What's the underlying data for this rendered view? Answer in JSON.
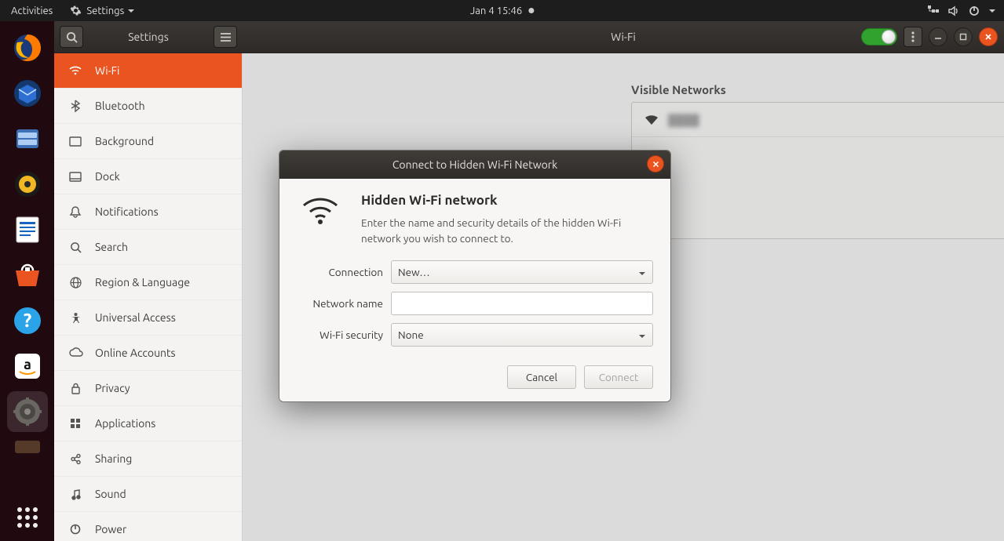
{
  "topbar": {
    "activities": "Activities",
    "app_menu": "Settings",
    "clock": "Jan 4  15:46"
  },
  "window": {
    "app_title": "Settings",
    "page_title": "Wi-Fi"
  },
  "sidebar": {
    "items": [
      {
        "label": "Wi-Fi"
      },
      {
        "label": "Bluetooth"
      },
      {
        "label": "Background"
      },
      {
        "label": "Dock"
      },
      {
        "label": "Notifications"
      },
      {
        "label": "Search"
      },
      {
        "label": "Region & Language"
      },
      {
        "label": "Universal Access"
      },
      {
        "label": "Online Accounts"
      },
      {
        "label": "Privacy"
      },
      {
        "label": "Applications"
      },
      {
        "label": "Sharing"
      },
      {
        "label": "Sound"
      },
      {
        "label": "Power"
      }
    ]
  },
  "content": {
    "section_title": "Visible Networks",
    "network_name_redacted": "████"
  },
  "dialog": {
    "title": "Connect to Hidden Wi-Fi Network",
    "heading": "Hidden Wi-Fi network",
    "description": "Enter the name and security details of the hidden Wi-Fi network you wish to connect to.",
    "labels": {
      "connection": "Connection",
      "network_name": "Network name",
      "wifi_security": "Wi-Fi security"
    },
    "values": {
      "connection": "New…",
      "network_name": "",
      "wifi_security": "None"
    },
    "buttons": {
      "cancel": "Cancel",
      "connect": "Connect"
    }
  }
}
